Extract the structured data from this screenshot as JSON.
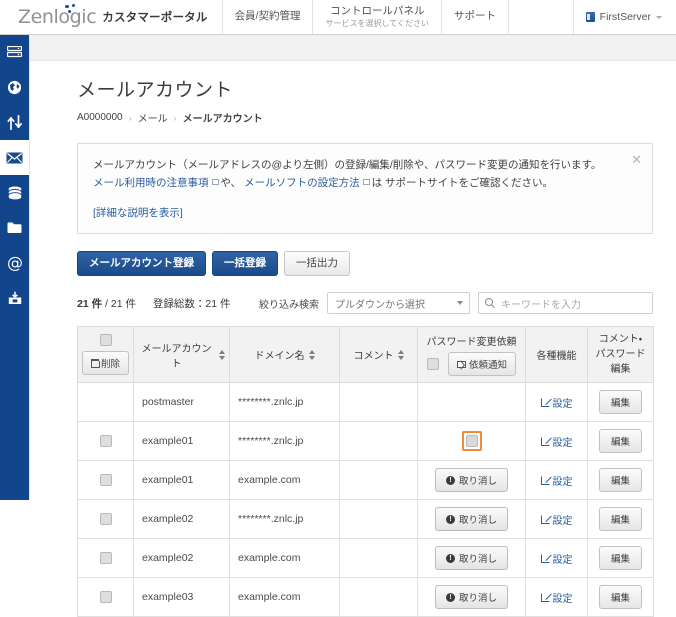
{
  "header": {
    "logo_text": "Zenlogic",
    "logo_sub": "カスタマーポータル",
    "nav": [
      {
        "label": "会員/契約管理",
        "sub": ""
      },
      {
        "label": "コントロールパネル",
        "sub": "サービスを選択してください"
      },
      {
        "label": "サポート",
        "sub": ""
      }
    ],
    "account_label": "FirstServer"
  },
  "rail": {
    "items": [
      {
        "icon": "server-icon",
        "active": false
      },
      {
        "icon": "globe-icon",
        "active": false
      },
      {
        "icon": "transfer-icon",
        "active": false
      },
      {
        "icon": "mail-icon",
        "active": true
      },
      {
        "icon": "database-icon",
        "active": false
      },
      {
        "icon": "folder-icon",
        "active": false
      },
      {
        "icon": "at-icon",
        "active": false
      },
      {
        "icon": "backup-icon",
        "active": false
      }
    ],
    "expand_glyph": "»"
  },
  "page": {
    "title": "メールアカウント",
    "breadcrumb": [
      "A0000000",
      "メール",
      "メールアカウント"
    ],
    "breadcrumb_sep": "›"
  },
  "notice": {
    "line1": "メールアカウント（メールアドレスの@より左側）の登録/編集/削除や、パスワード変更の通知を行います。",
    "link1": "メール利用時の注意事項",
    "mid1": "や、",
    "link2": "メールソフトの設定方法",
    "mid2": "は サポートサイトをご確認ください。",
    "detail_link": "[詳細な説明を表示]",
    "close_glyph": "✕"
  },
  "toolbar": {
    "register_label": "メールアカウント登録",
    "bulk_register_label": "一括登録",
    "bulk_export_label": "一括出力"
  },
  "filter": {
    "count_shown": "21 件",
    "count_slash": "/",
    "count_of": "21 件",
    "total_label": "登録総数：21 件",
    "search_label": "絞り込み検索",
    "select_value": "プルダウンから選択",
    "keyword_placeholder": "キーワードを入力"
  },
  "table": {
    "headers": {
      "delete_button": "削除",
      "mail_account": "メールアカウント",
      "domain": "ドメイン名",
      "comment": "コメント",
      "password_request": "パスワード変更依頼",
      "notify_button": "依頼通知",
      "functions": "各種機能",
      "comment_password_edit": "コメント・\nパスワード\n編集"
    },
    "labels": {
      "cancel": "取り消し",
      "settings": "設定",
      "edit": "編集"
    },
    "rows": [
      {
        "checkbox": false,
        "has_checkbox": false,
        "account": "postmaster",
        "domain": "********.znlc.jp",
        "comment": "",
        "pwd_state": "none",
        "pwd_focused": false,
        "settings": "設定",
        "edit": "編集"
      },
      {
        "checkbox": false,
        "has_checkbox": true,
        "account": "example01",
        "domain": "********.znlc.jp",
        "comment": "",
        "pwd_state": "checkbox",
        "pwd_focused": true,
        "settings": "設定",
        "edit": "編集"
      },
      {
        "checkbox": false,
        "has_checkbox": true,
        "account": "example01",
        "domain": "example.com",
        "comment": "",
        "pwd_state": "cancel",
        "pwd_focused": false,
        "settings": "設定",
        "edit": "編集"
      },
      {
        "checkbox": false,
        "has_checkbox": true,
        "account": "example02",
        "domain": "********.znlc.jp",
        "comment": "",
        "pwd_state": "cancel",
        "pwd_focused": false,
        "settings": "設定",
        "edit": "編集"
      },
      {
        "checkbox": false,
        "has_checkbox": true,
        "account": "example02",
        "domain": "example.com",
        "comment": "",
        "pwd_state": "cancel",
        "pwd_focused": false,
        "settings": "設定",
        "edit": "編集"
      },
      {
        "checkbox": false,
        "has_checkbox": true,
        "account": "example03",
        "domain": "example.com",
        "comment": "",
        "pwd_state": "cancel",
        "pwd_focused": false,
        "settings": "設定",
        "edit": "編集"
      }
    ]
  },
  "colors": {
    "rail_blue": "#13458c",
    "primary_button": "#1b4a88",
    "link_blue": "#2b5c9e",
    "focus_orange": "#f08a3c"
  }
}
